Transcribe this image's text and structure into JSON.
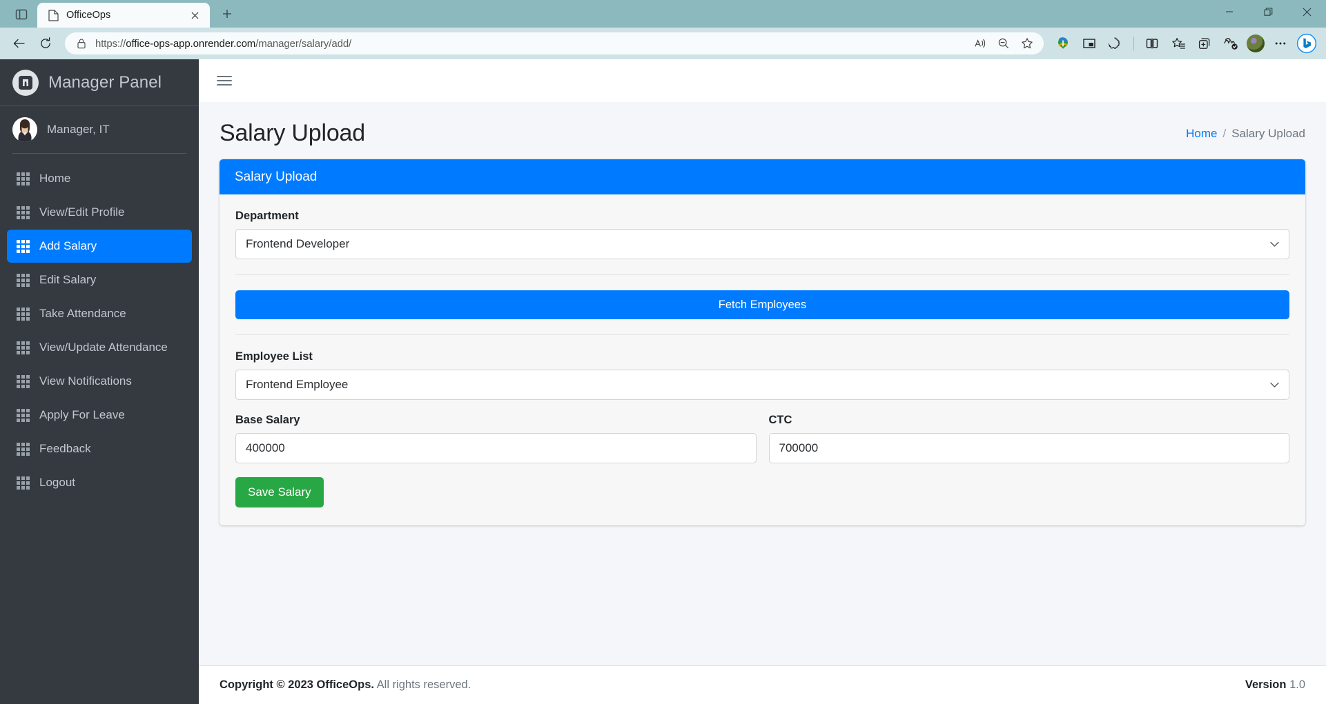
{
  "browser": {
    "sidebar_toggle_icon": "browser-sidebar-icon",
    "tab": {
      "title": "OfficeOps",
      "favicon": "page-icon",
      "close_icon": "close-icon"
    },
    "new_tab_icon": "plus-icon",
    "window_controls": {
      "minimize": "minimize-icon",
      "maximize": "maximize-icon",
      "close": "close-icon"
    },
    "nav": {
      "back_icon": "back-arrow-icon",
      "reload_icon": "reload-icon"
    },
    "address": {
      "lock_icon": "lock-icon",
      "url_scheme": "https://",
      "url_host": "office-ops-app.onrender.com",
      "url_path": "/manager/salary/add/"
    },
    "omnibox_actions": [
      "read-aloud-icon",
      "zoom-out-icon",
      "favorite-star-icon"
    ],
    "toolbar_icons": [
      "idm-download-icon",
      "picture-in-picture-icon",
      "extensions-puzzle-icon",
      "split-screen-icon",
      "favorites-icon",
      "collections-icon",
      "browser-essentials-icon"
    ],
    "profile_icon": "profile-avatar",
    "more_icon": "more-options-icon",
    "copilot_icon": "copilot-bing-icon"
  },
  "sidebar": {
    "brand": {
      "logo_icon": "officeops-logo-icon",
      "title": "Manager Panel"
    },
    "user": {
      "avatar_icon": "user-avatar",
      "name": "Manager, IT"
    },
    "items": [
      {
        "label": "Home",
        "icon": "grid-icon",
        "active": false
      },
      {
        "label": "View/Edit Profile",
        "icon": "grid-icon",
        "active": false
      },
      {
        "label": "Add Salary",
        "icon": "grid-icon",
        "active": true
      },
      {
        "label": "Edit Salary",
        "icon": "grid-icon",
        "active": false
      },
      {
        "label": "Take Attendance",
        "icon": "grid-icon",
        "active": false
      },
      {
        "label": "View/Update Attendance",
        "icon": "grid-icon",
        "active": false
      },
      {
        "label": "View Notifications",
        "icon": "grid-icon",
        "active": false
      },
      {
        "label": "Apply For Leave",
        "icon": "grid-icon",
        "active": false
      },
      {
        "label": "Feedback",
        "icon": "grid-icon",
        "active": false
      },
      {
        "label": "Logout",
        "icon": "grid-icon",
        "active": false
      }
    ]
  },
  "topbar": {
    "menu_icon": "hamburger-menu-icon"
  },
  "page": {
    "title": "Salary Upload",
    "breadcrumb": {
      "home": "Home",
      "separator": "/",
      "current": "Salary Upload"
    }
  },
  "card": {
    "header": "Salary Upload",
    "department": {
      "label": "Department",
      "value": "Frontend Developer",
      "options": [
        "Frontend Developer"
      ],
      "chevron_icon": "chevron-down-icon"
    },
    "fetch_button": "Fetch Employees",
    "employee_list": {
      "label": "Employee List",
      "value": "Frontend Employee",
      "options": [
        "Frontend Employee"
      ],
      "chevron_icon": "chevron-down-icon"
    },
    "base_salary": {
      "label": "Base Salary",
      "value": "400000",
      "placeholder": "Base Salary"
    },
    "ctc": {
      "label": "CTC",
      "value": "700000",
      "placeholder": "CTC"
    },
    "save_button": "Save Salary"
  },
  "footer": {
    "copyright_strong": "Copyright © 2023 OfficeOps.",
    "copyright_rest": " All rights reserved.",
    "version_label": "Version",
    "version_value": "1.0"
  },
  "colors": {
    "primary": "#007bff",
    "success": "#28a745",
    "sidebar_bg": "#343a40",
    "sidebar_text": "#c2c7d0",
    "content_bg": "#f4f6f9"
  }
}
